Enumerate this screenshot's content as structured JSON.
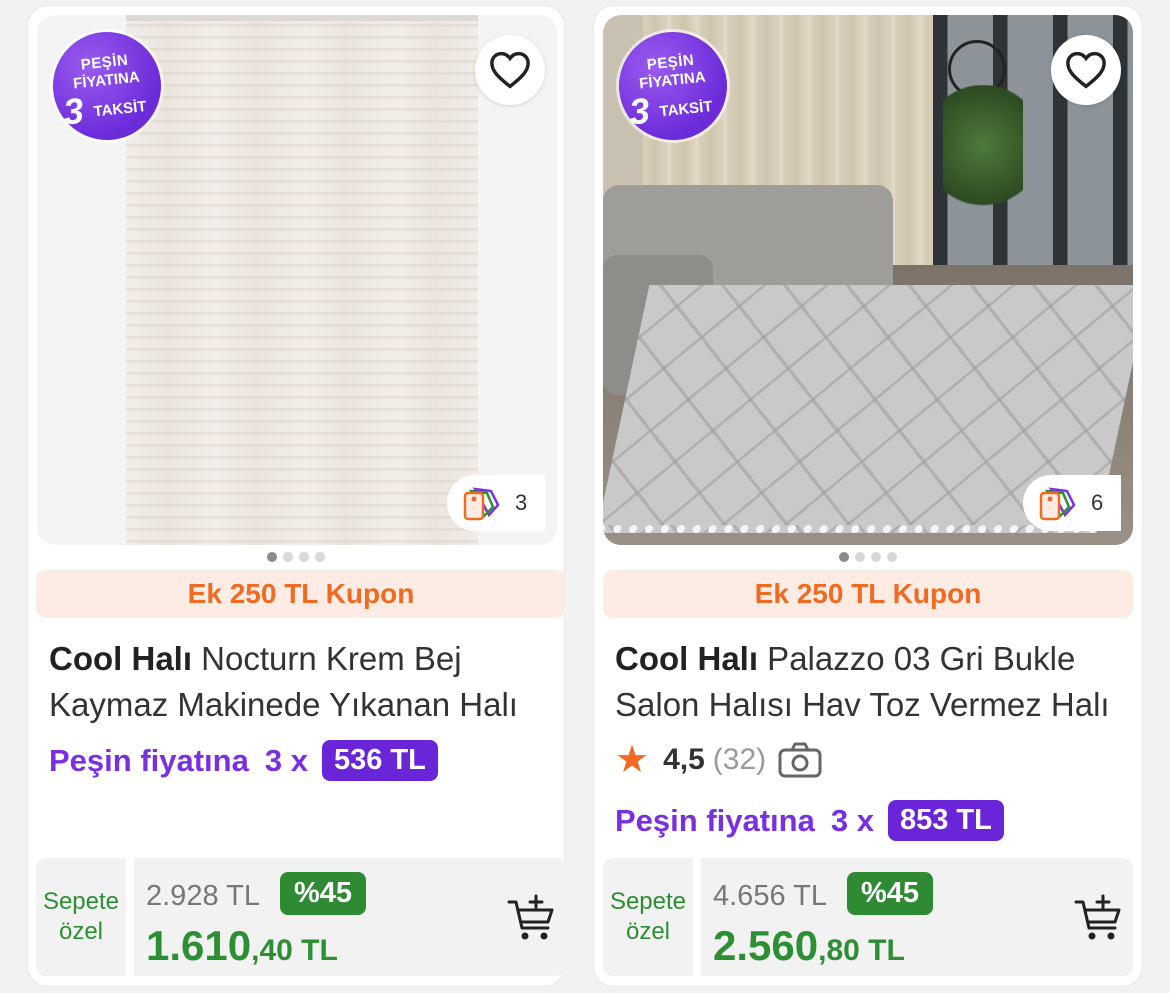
{
  "products": [
    {
      "badge": {
        "line1": "PEŞİN",
        "line2": "FİYATINA",
        "line3": "3",
        "line4": "TAKSİT"
      },
      "variant_count": "3",
      "coupon": "Ek 250 TL Kupon",
      "brand": "Cool Halı",
      "name": " Nocturn Krem Bej Kaymaz Makinede Yıkanan Halı",
      "installment_label": "Peşin fiyatına",
      "installment_count": "3 x",
      "installment_amount": "536 TL",
      "sepete_line1": "Sepete",
      "sepete_line2": "özel",
      "old_price": "2.928 TL",
      "discount": "%45",
      "price_main": "1.610",
      "price_cents": ",40 TL"
    },
    {
      "badge": {
        "line1": "PEŞİN",
        "line2": "FİYATINA",
        "line3": "3",
        "line4": "TAKSİT"
      },
      "variant_count": "6",
      "coupon": "Ek 250 TL Kupon",
      "brand": "Cool Halı",
      "name": " Palazzo 03 Gri Bukle Salon Halısı Hav Toz Vermez Halı",
      "rating": "4,5",
      "rating_count": "(32)",
      "installment_label": "Peşin fiyatına",
      "installment_count": "3 x",
      "installment_amount": "853 TL",
      "sepete_line1": "Sepete",
      "sepete_line2": "özel",
      "old_price": "4.656 TL",
      "discount": "%45",
      "price_main": "2.560",
      "price_cents": ",80 TL"
    }
  ],
  "icons": {
    "favorite": "heart-icon",
    "variant": "price-tags-icon",
    "cart": "add-to-cart-icon",
    "star": "star-icon",
    "camera": "camera-icon"
  },
  "colors": {
    "brand_purple": "#6a25d9",
    "coupon_orange": "#ef6a22",
    "price_green": "#2d8f34",
    "discount_green": "#2e8b34"
  }
}
